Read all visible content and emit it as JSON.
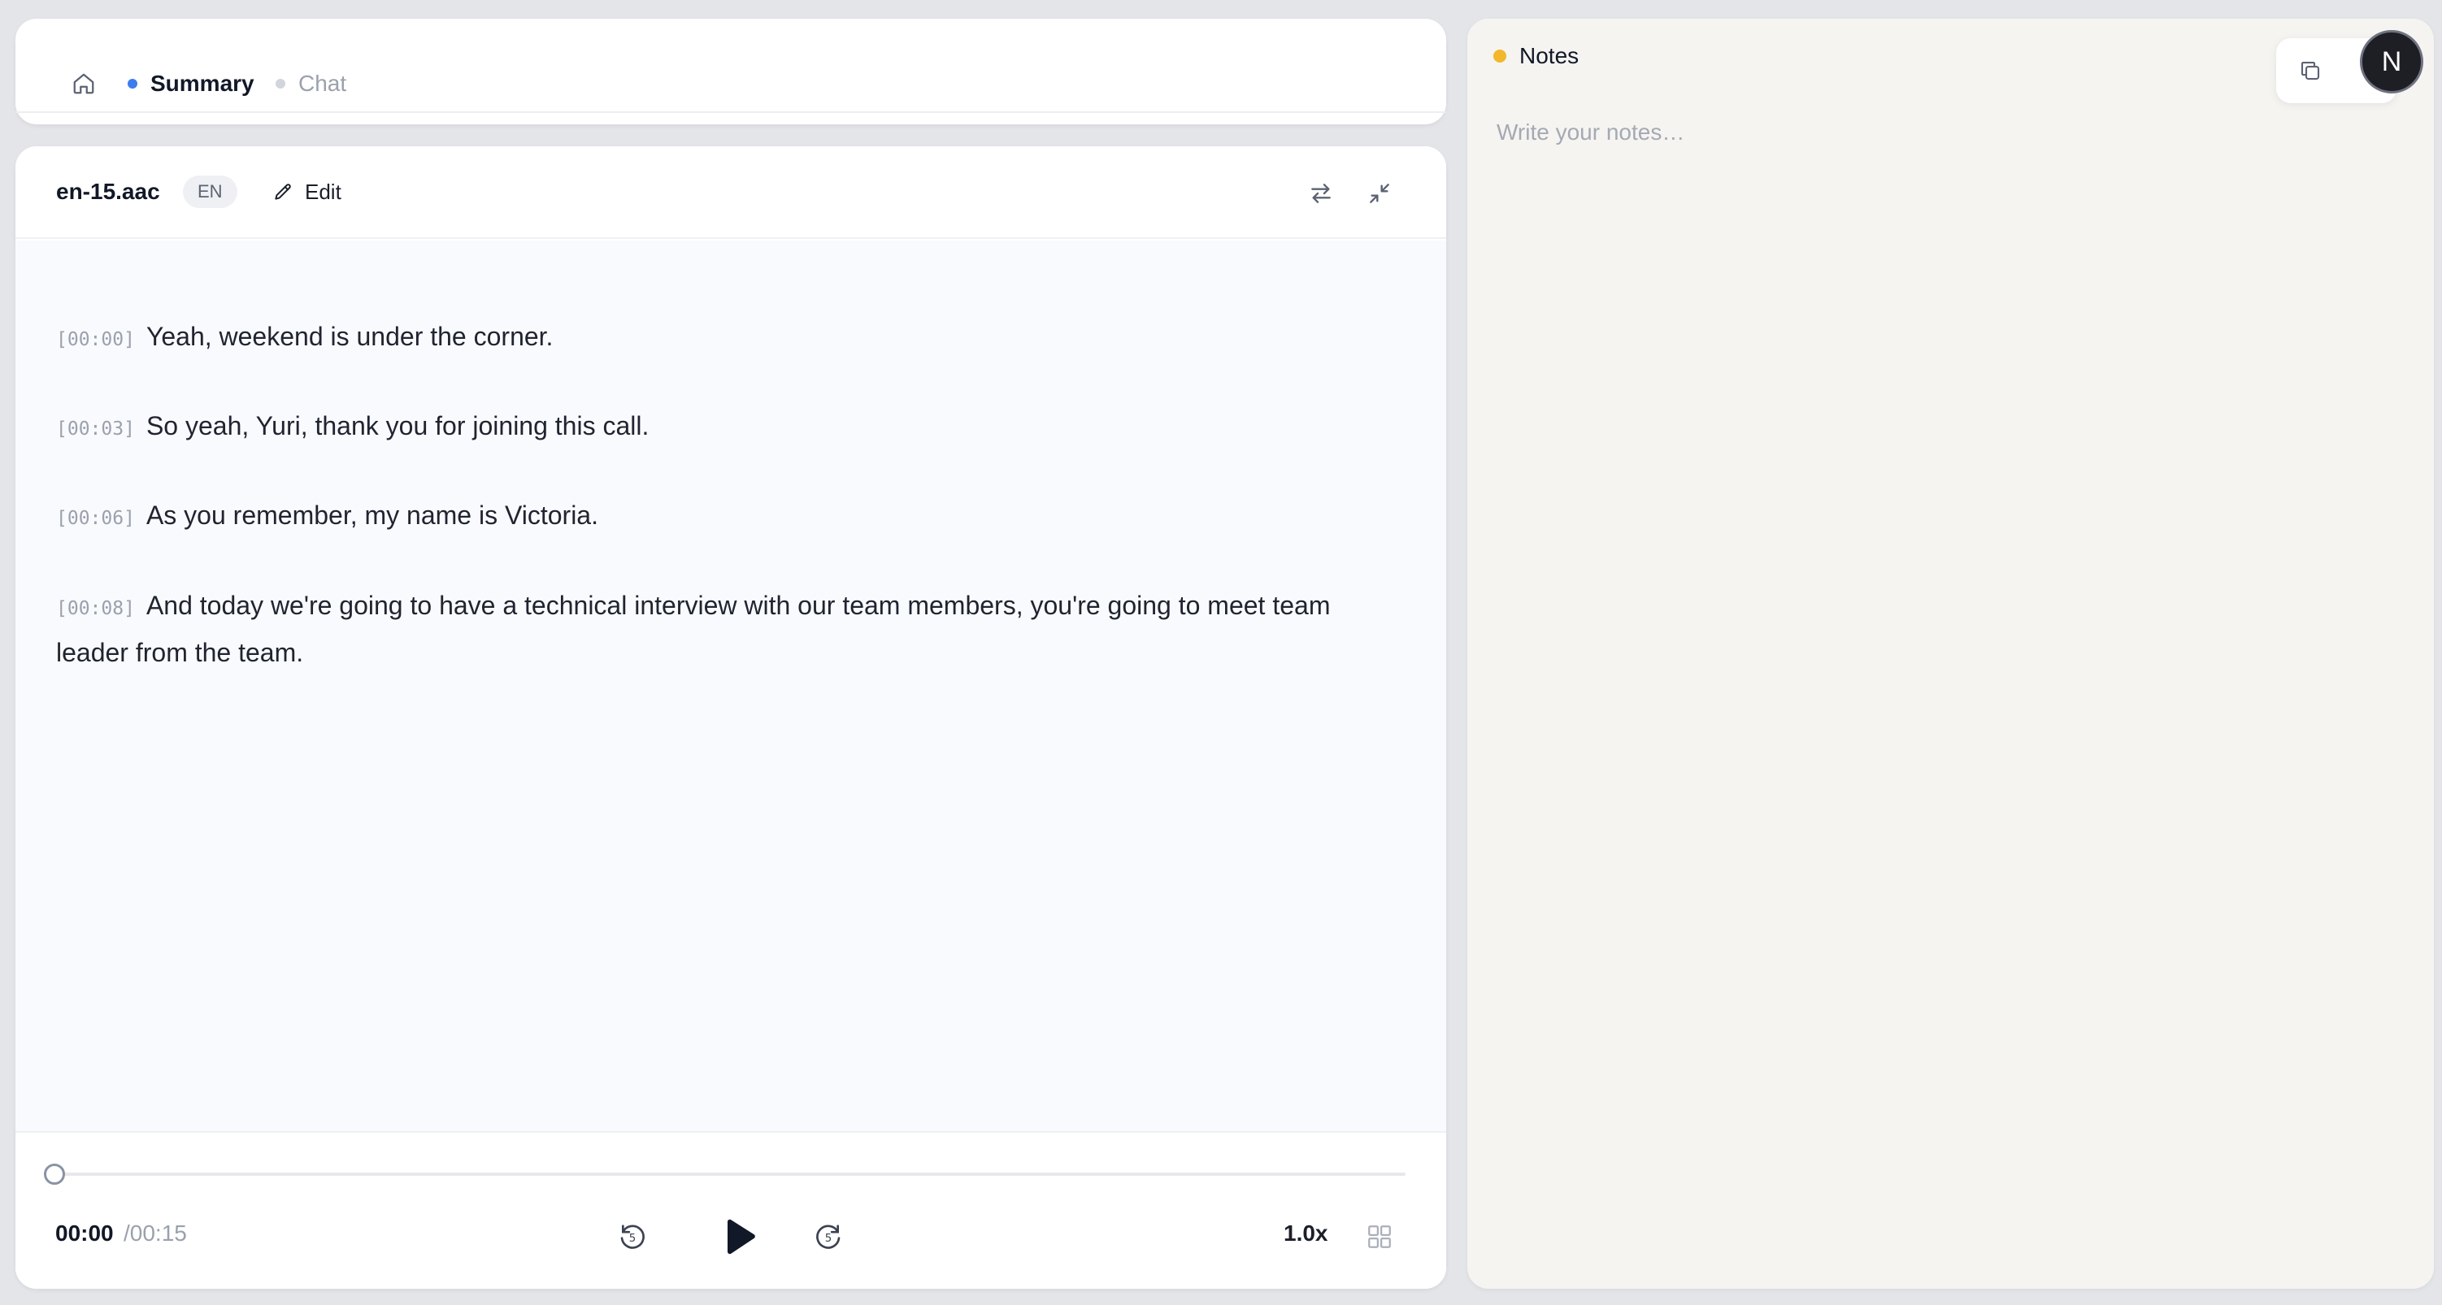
{
  "tabs": {
    "home_icon": "home-icon",
    "items": [
      {
        "label": "Summary",
        "active": true,
        "dot_color": "#3b7ded"
      },
      {
        "label": "Chat",
        "active": false,
        "dot_color": "#d2d5db"
      }
    ]
  },
  "transcript": {
    "filename": "en-15.aac",
    "language": "EN",
    "edit_label": "Edit",
    "icons": [
      "pencil-icon",
      "swap-icon",
      "collapse-icon"
    ],
    "segments": [
      {
        "timestamp": "[00:00]",
        "text": "Yeah, weekend is under the corner."
      },
      {
        "timestamp": "[00:03]",
        "text": "So yeah, Yuri, thank you for joining this call."
      },
      {
        "timestamp": "[00:06]",
        "text": "As you remember, my name is Victoria."
      },
      {
        "timestamp": "[00:08]",
        "text": "And today we're going to have a technical interview with our team members, you're going to meet team leader from the team."
      }
    ]
  },
  "player": {
    "current_time": "00:00",
    "total_time": "/00:15",
    "progress": 0,
    "speed": "1.0x",
    "icons": [
      "rewind-5-icon",
      "play-icon",
      "forward-5-icon",
      "grid-icon"
    ]
  },
  "notes": {
    "title": "Notes",
    "dot_color": "#f2b72b",
    "placeholder": "Write your notes…",
    "copy_icon": "copy-icon",
    "avatar_initial": "N"
  }
}
